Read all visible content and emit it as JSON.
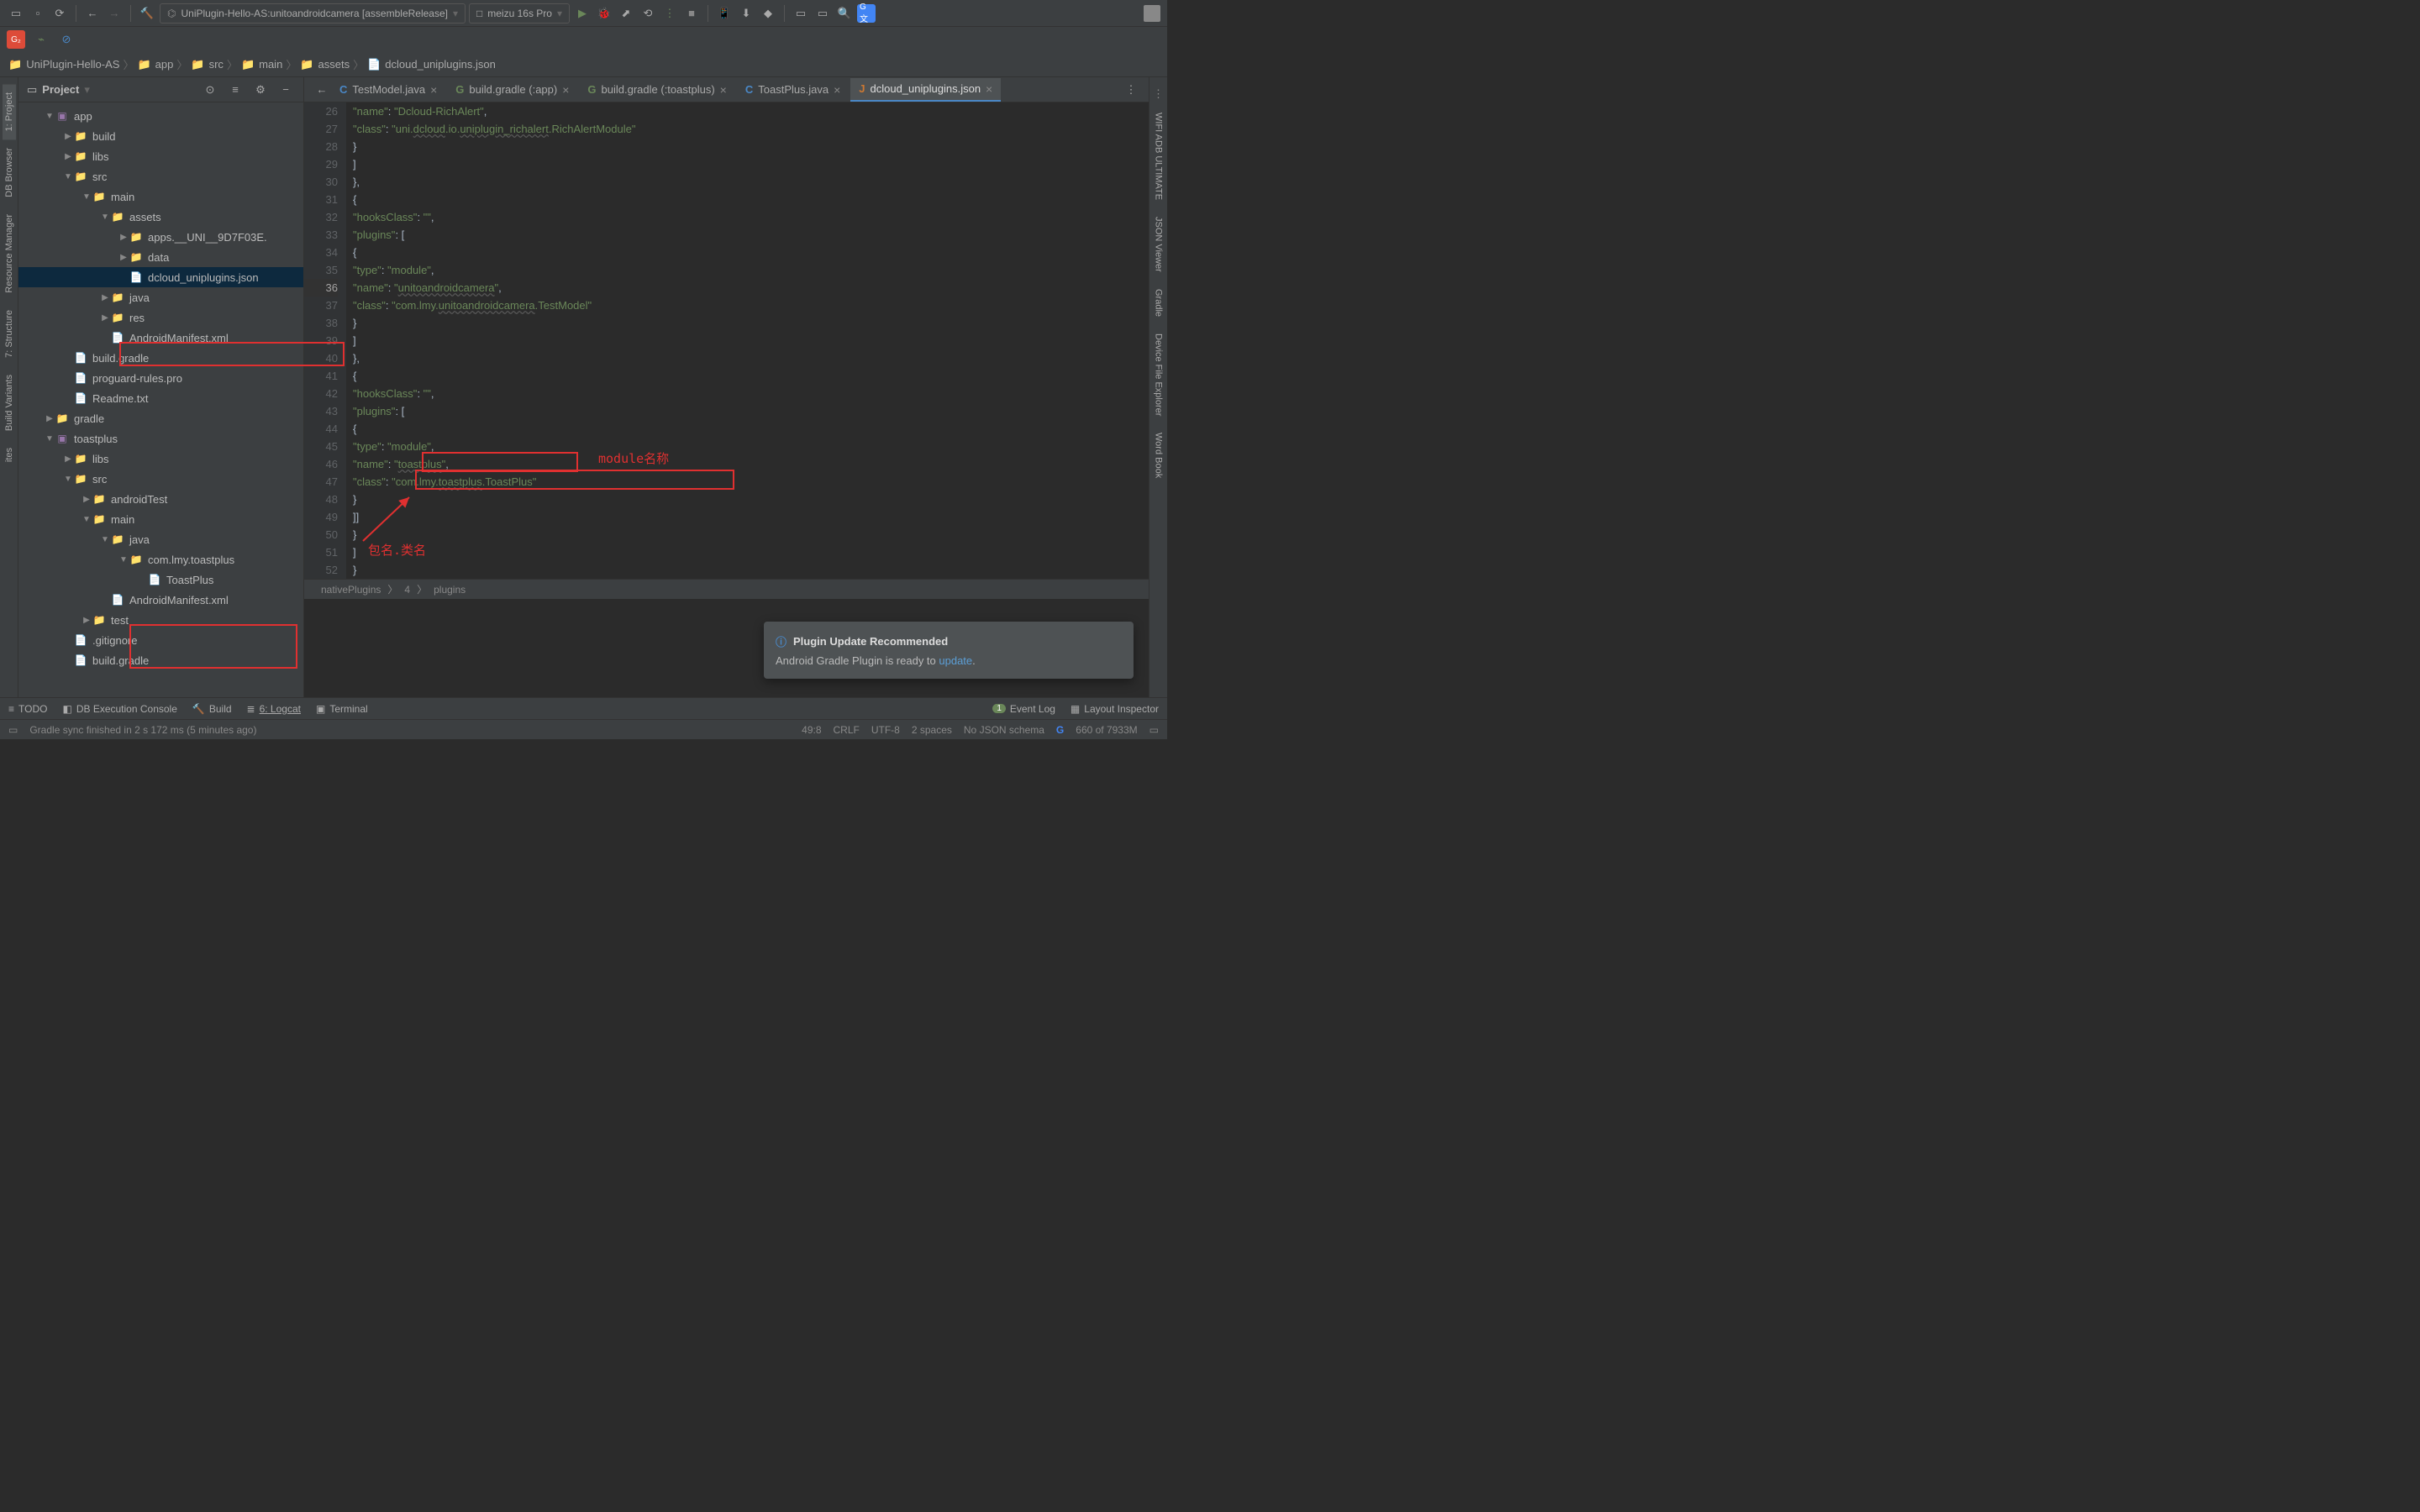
{
  "toolbar": {
    "run_config": "UniPlugin-Hello-AS:unitoandroidcamera [assembleRelease]",
    "device": "meizu 16s Pro"
  },
  "breadcrumb": [
    "UniPlugin-Hello-AS",
    "app",
    "src",
    "main",
    "assets",
    "dcloud_uniplugins.json"
  ],
  "panel": {
    "title": "Project"
  },
  "left_tabs": [
    "1: Project",
    "DB Browser",
    "Resource Manager",
    "7: Structure",
    "Build Variants",
    "ites"
  ],
  "right_tabs": [
    "WIFI ADB ULTIMATE",
    "JSON Viewer",
    "Gradle",
    "Device File Explorer",
    "Word Book"
  ],
  "tree": [
    {
      "d": 0,
      "exp": "▼",
      "t": "app",
      "cls": "module"
    },
    {
      "d": 1,
      "exp": "▶",
      "t": "build",
      "cls": "folder orange"
    },
    {
      "d": 1,
      "exp": "▶",
      "t": "libs",
      "cls": "folder"
    },
    {
      "d": 1,
      "exp": "▼",
      "t": "src",
      "cls": "folder"
    },
    {
      "d": 2,
      "exp": "▼",
      "t": "main",
      "cls": "folder"
    },
    {
      "d": 3,
      "exp": "▼",
      "t": "assets",
      "cls": "folder"
    },
    {
      "d": 4,
      "exp": "▶",
      "t": "apps.__UNI__9D7F03E.",
      "cls": "folder"
    },
    {
      "d": 4,
      "exp": "▶",
      "t": "data",
      "cls": "folder"
    },
    {
      "d": 4,
      "exp": "",
      "t": "dcloud_uniplugins.json",
      "cls": "file",
      "sel": true
    },
    {
      "d": 3,
      "exp": "▶",
      "t": "java",
      "cls": "folder"
    },
    {
      "d": 3,
      "exp": "▶",
      "t": "res",
      "cls": "folder"
    },
    {
      "d": 3,
      "exp": "",
      "t": "AndroidManifest.xml",
      "cls": "file"
    },
    {
      "d": 1,
      "exp": "",
      "t": "build.gradle",
      "cls": "file"
    },
    {
      "d": 1,
      "exp": "",
      "t": "proguard-rules.pro",
      "cls": "file"
    },
    {
      "d": 1,
      "exp": "",
      "t": "Readme.txt",
      "cls": "file"
    },
    {
      "d": 0,
      "exp": "▶",
      "t": "gradle",
      "cls": "folder"
    },
    {
      "d": 0,
      "exp": "▼",
      "t": "toastplus",
      "cls": "module"
    },
    {
      "d": 1,
      "exp": "▶",
      "t": "libs",
      "cls": "folder"
    },
    {
      "d": 1,
      "exp": "▼",
      "t": "src",
      "cls": "folder"
    },
    {
      "d": 2,
      "exp": "▶",
      "t": "androidTest",
      "cls": "folder"
    },
    {
      "d": 2,
      "exp": "▼",
      "t": "main",
      "cls": "folder"
    },
    {
      "d": 3,
      "exp": "▼",
      "t": "java",
      "cls": "folder"
    },
    {
      "d": 4,
      "exp": "▼",
      "t": "com.lmy.toastplus",
      "cls": "folder"
    },
    {
      "d": 5,
      "exp": "",
      "t": "ToastPlus",
      "cls": "file"
    },
    {
      "d": 3,
      "exp": "",
      "t": "AndroidManifest.xml",
      "cls": "file"
    },
    {
      "d": 2,
      "exp": "▶",
      "t": "test",
      "cls": "folder"
    },
    {
      "d": 1,
      "exp": "",
      "t": ".gitignore",
      "cls": "file"
    },
    {
      "d": 1,
      "exp": "",
      "t": "build.gradle",
      "cls": "file"
    }
  ],
  "tabs": [
    {
      "label": "TestModel.java",
      "icon": "C"
    },
    {
      "label": "build.gradle (:app)",
      "icon": "G"
    },
    {
      "label": "build.gradle (:toastplus)",
      "icon": "G"
    },
    {
      "label": "ToastPlus.java",
      "icon": "C"
    },
    {
      "label": "dcloud_uniplugins.json",
      "icon": "J",
      "active": true
    }
  ],
  "code": {
    "start": 26,
    "lines": [
      "            \"name\": \"Dcloud-RichAlert\",",
      "            \"class\": \"uni.dcloud.io.uniplugin_richalert.RichAlertModule\"",
      "          }",
      "        ]",
      "      },",
      "      {",
      "        \"hooksClass\": \"\",",
      "        \"plugins\": [",
      "          {",
      "            \"type\": \"module\",",
      "            \"name\": \"unitoandroidcamera\",",
      "            \"class\": \"com.lmy.unitoandroidcamera.TestModel\"",
      "          }",
      "        ]",
      "      },",
      "      {",
      "        \"hooksClass\": \"\",",
      "        \"plugins\": [",
      "          {",
      "            \"type\": \"module\",",
      "            \"name\": \"toastplus\",",
      "            \"class\": \"com.lmy.toastplus.ToastPlus\"",
      "          }",
      "        ]]",
      "      }",
      "    ]",
      "}"
    ],
    "hl_line": 36
  },
  "crumb": [
    "nativePlugins",
    "4",
    "plugins"
  ],
  "annotations": {
    "module_name": "module名称",
    "pkg_class": "包名.类名"
  },
  "bottom": {
    "todo": "TODO",
    "db": "DB Execution Console",
    "build": "Build",
    "logcat": "6: Logcat",
    "terminal": "Terminal",
    "event": "Event Log",
    "layout": "Layout Inspector"
  },
  "status": {
    "sync": "Gradle sync finished in 2 s 172 ms (5 minutes ago)",
    "pos": "49:8",
    "eol": "CRLF",
    "enc": "UTF-8",
    "indent": "2 spaces",
    "schema": "No JSON schema",
    "mem": "660 of 7933M"
  },
  "notification": {
    "title": "Plugin Update Recommended",
    "body_pre": "Android Gradle Plugin is ready to ",
    "body_link": "update"
  }
}
